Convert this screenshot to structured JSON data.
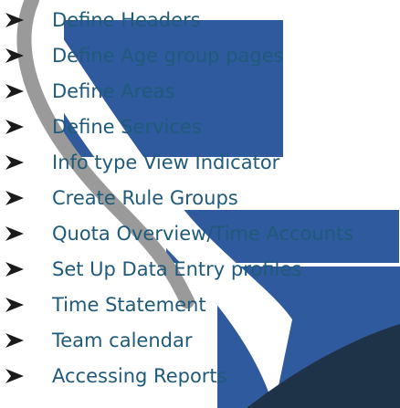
{
  "slide": {
    "items": [
      {
        "label": "Define Headers"
      },
      {
        "label": "Define Age group pages"
      },
      {
        "label": "Define Areas"
      },
      {
        "label": "Define Services"
      },
      {
        "label": "Info type View Indicator"
      },
      {
        "label": "Create Rule Groups"
      },
      {
        "label": "Quota Overview/Time Accounts"
      },
      {
        "label": "Set Up Data Entry profiles"
      },
      {
        "label": "Time Statement"
      },
      {
        "label": "Team calendar"
      },
      {
        "label": "Accessing Reports"
      }
    ],
    "bullet_icon": "arrowhead-bullet-icon",
    "text_color": "#1f5a7a",
    "accent_color": "#2f5a9e",
    "dark_color": "#1e3348"
  }
}
